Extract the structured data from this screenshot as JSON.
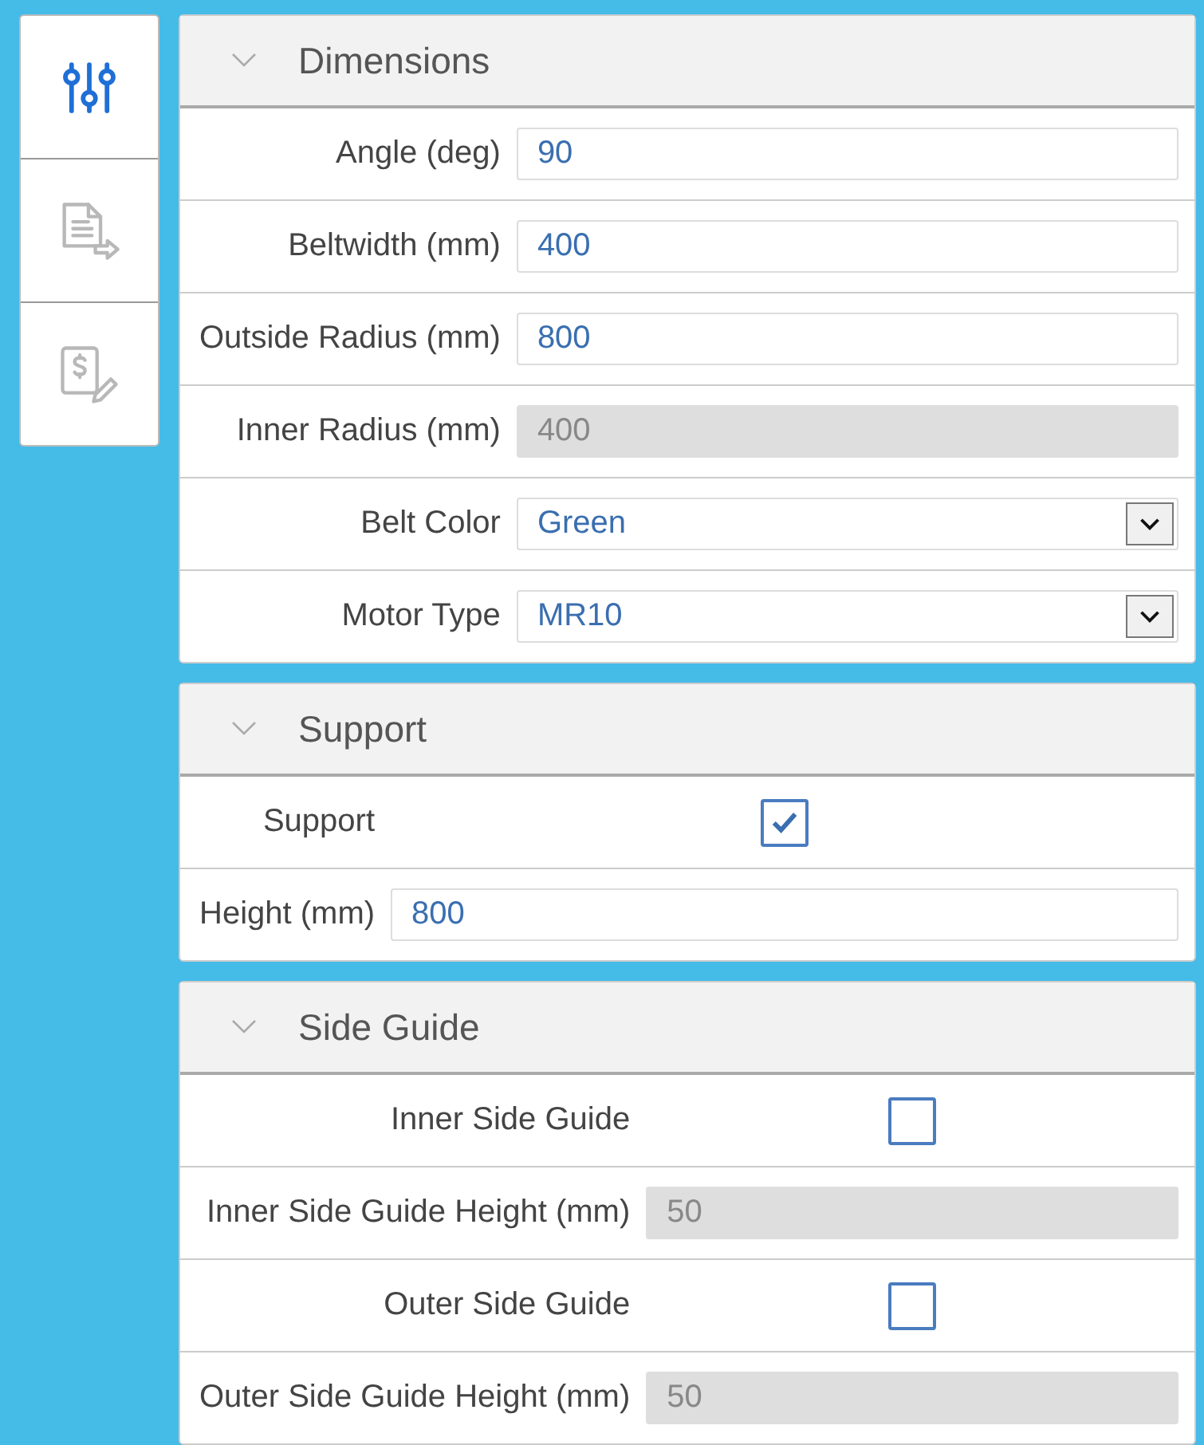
{
  "sidebar": {
    "tabs": [
      {
        "kind": "sliders",
        "selected": true
      },
      {
        "kind": "export",
        "selected": false
      },
      {
        "kind": "quote",
        "selected": false
      }
    ]
  },
  "sections": [
    {
      "title": "Dimensions",
      "expanded": true,
      "fields": [
        {
          "label": "Angle (deg)",
          "kind": "input",
          "value": "90",
          "disabled": false
        },
        {
          "label": "Beltwidth (mm)",
          "kind": "input",
          "value": "400",
          "disabled": false
        },
        {
          "label": "Outside Radius (mm)",
          "kind": "input",
          "value": "800",
          "disabled": false
        },
        {
          "label": "Inner Radius (mm)",
          "kind": "input",
          "value": "400",
          "disabled": true
        },
        {
          "label": "Belt Color",
          "kind": "select",
          "value": "Green"
        },
        {
          "label": "Motor Type",
          "kind": "select",
          "value": "MR10"
        }
      ]
    },
    {
      "title": "Support",
      "expanded": true,
      "fields": [
        {
          "label": "Support",
          "kind": "checkbox",
          "checked": true
        },
        {
          "label": "Height (mm)",
          "kind": "input",
          "value": "800",
          "disabled": false
        }
      ]
    },
    {
      "title": "Side Guide",
      "expanded": true,
      "fields": [
        {
          "label": "Inner Side Guide",
          "kind": "checkbox",
          "checked": false
        },
        {
          "label": "Inner Side Guide Height (mm)",
          "kind": "input",
          "value": "50",
          "disabled": true
        },
        {
          "label": "Outer Side Guide",
          "kind": "checkbox",
          "checked": false
        },
        {
          "label": "Outer Side Guide Height (mm)",
          "kind": "input",
          "value": "50",
          "disabled": true
        }
      ]
    }
  ]
}
